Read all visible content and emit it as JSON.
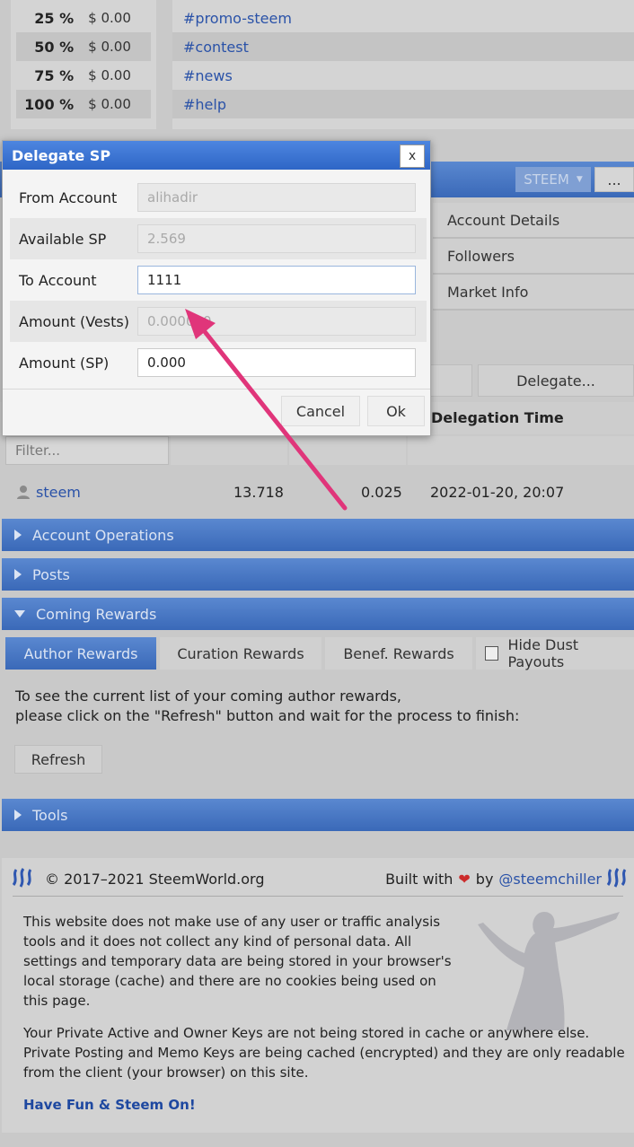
{
  "rewards_table": [
    {
      "pct": "25 %",
      "amount": "$ 0.00"
    },
    {
      "pct": "50 %",
      "amount": "$ 0.00"
    },
    {
      "pct": "75 %",
      "amount": "$ 0.00"
    },
    {
      "pct": "100 %",
      "amount": "$ 0.00"
    }
  ],
  "tags": [
    "#promo-steem",
    "#contest",
    "#news",
    "#help"
  ],
  "header": {
    "currency": "STEEM",
    "more": "..."
  },
  "side_menu": [
    "Account Details",
    "Followers",
    "Market Info"
  ],
  "delegate_button": "Delegate...",
  "delegation_table": {
    "time_header": "Delegation Time",
    "filter_placeholder": "Filter...",
    "row": {
      "account": "steem",
      "value1": "13.718",
      "value2": "0.025",
      "time": "2022-01-20, 20:07"
    }
  },
  "sections": {
    "account_operations": "Account Operations",
    "posts": "Posts",
    "coming_rewards": "Coming Rewards",
    "tools": "Tools"
  },
  "reward_tabs": {
    "author": "Author Rewards",
    "curation": "Curation Rewards",
    "benef": "Benef. Rewards",
    "hide_dust": "Hide Dust Payouts"
  },
  "rewards_text": {
    "line1": "To see the current list of your coming author rewards,",
    "line2": "please click on the \"Refresh\" button and wait for the process to finish:",
    "refresh": "Refresh"
  },
  "footer": {
    "copyright": "© 2017–2021 SteemWorld.org",
    "built_with": "Built with",
    "by": "by",
    "author": "@steemchiller",
    "p1": "This website does not make use of any user or traffic analysis tools and it does not collect any kind of personal data. All settings and temporary data are being stored in your browser's local storage (cache) and there are no cookies being used on this page.",
    "p2": "Your Private Active and Owner Keys are not being stored in cache or anywhere else. Private Posting and Memo Keys are being cached (encrypted) and they are only readable from the client (your browser) on this site.",
    "motto": "Have Fun & Steem On!"
  },
  "modal": {
    "title": "Delegate SP",
    "close": "x",
    "from_label": "From Account",
    "from_value": "alihadir",
    "available_label": "Available SP",
    "available_value": "2.569",
    "to_label": "To Account",
    "to_value": "1111",
    "vests_label": "Amount (Vests)",
    "vests_value": "0.000000",
    "sp_label": "Amount (SP)",
    "sp_value": "0.000",
    "cancel": "Cancel",
    "ok": "Ok"
  },
  "colors": {
    "accent": "#3a69b8",
    "arrow": "#e0357a",
    "link": "#2a52a8"
  }
}
